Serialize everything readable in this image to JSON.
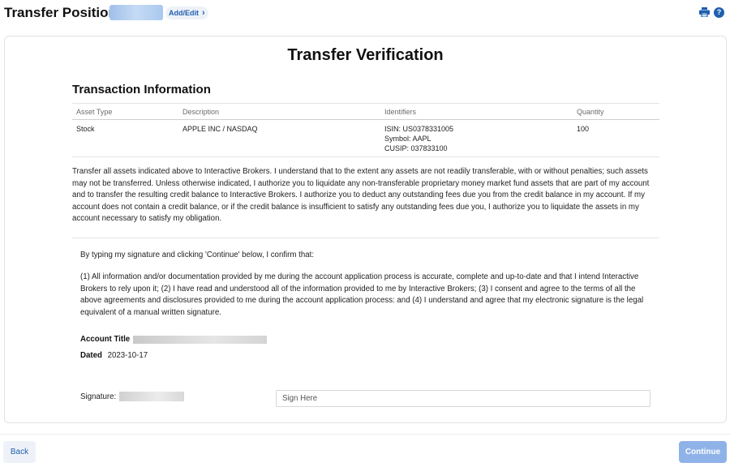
{
  "header": {
    "title": "Transfer Positions",
    "add_edit_label": "Add/Edit",
    "icons": [
      "chevron-right-icon",
      "print-icon",
      "help-icon"
    ],
    "help_glyph": "?"
  },
  "card": {
    "title": "Transfer Verification",
    "section_title": "Transaction Information",
    "table": {
      "headers": [
        "Asset Type",
        "Description",
        "Identifiers",
        "Quantity"
      ],
      "rows": [
        {
          "asset_type": "Stock",
          "description": "APPLE INC / NASDAQ",
          "identifiers": [
            "ISIN: US0378331005",
            "Symbol: AAPL",
            "CUSIP: 037833100"
          ],
          "quantity": "100"
        }
      ]
    },
    "terms_text": "Transfer all assets indicated above to Interactive Brokers. I understand that to the extent any assets are not readily transferable, with or without penalties; such assets may not be transferred. Unless otherwise indicated, I authorize you to liquidate any non-transferable proprietary money market fund assets that are part of my account and to transfer the resulting credit balance to Interactive Brokers. I authorize you to deduct any outstanding fees due you from the credit balance in my account. If my account does not contain a credit balance, or if the credit balance is insufficient to satisfy any outstanding fees due you, I authorize you to liquidate the assets in my account necessary to satisfy my obligation.",
    "confirm_intro": "By typing my signature and clicking 'Continue' below, I confirm that:",
    "confirm_list": "(1) All information and/or documentation provided by me during the account application process is accurate, complete and up-to-date and that I intend Interactive Brokers to rely upon it; (2) I have read and understood all of the information provided to me by Interactive Brokers; (3) I consent and agree to the terms of all the above agreements and disclosures provided to me during the account application process: and (4) I understand and agree that my electronic signature is the legal equivalent of a manual written signature.",
    "account_title_label": "Account Title",
    "dated_label": "Dated",
    "dated_value": "2023-10-17",
    "signature_label": "Signature:",
    "sign_placeholder": "Sign Here"
  },
  "footer": {
    "back_label": "Back",
    "continue_label": "Continue"
  },
  "colors": {
    "accent": "#1f5fae",
    "continue_disabled": "#8fb3e8",
    "back_bg": "#eef2f8"
  }
}
